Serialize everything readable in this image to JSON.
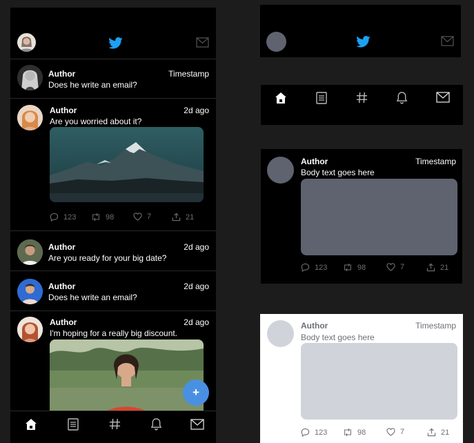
{
  "feed": {
    "tweets": [
      {
        "author": "Author",
        "time": "Timestamp",
        "text": "Does he write an email?"
      },
      {
        "author": "Author",
        "time": "2d ago",
        "text": "Are you worried about it?",
        "actions": {
          "replies": "123",
          "retweets": "98",
          "likes": "7",
          "shares": "21"
        }
      },
      {
        "author": "Author",
        "time": "2d ago",
        "text": "Are you ready for your big date?"
      },
      {
        "author": "Author",
        "time": "2d ago",
        "text": "Does he write an email?"
      },
      {
        "author": "Author",
        "time": "2d ago",
        "text": "I'm hoping for a really big discount."
      }
    ]
  },
  "fab": {
    "label": "+"
  },
  "template_dark": {
    "author": "Author",
    "time": "Timestamp",
    "text": "Body text goes here",
    "actions": {
      "replies": "123",
      "retweets": "98",
      "likes": "7",
      "shares": "21"
    }
  },
  "template_light": {
    "author": "Author",
    "time": "Timestamp",
    "text": "Body text goes here",
    "actions": {
      "replies": "123",
      "retweets": "98",
      "likes": "7",
      "shares": "21"
    }
  },
  "colors": {
    "accent": "#1da1f2",
    "fab": "#4a90e2",
    "panel": "#000000",
    "background": "#1c1c1c",
    "placeholder_dark": "#5f6370",
    "placeholder_light": "#d0d3d9"
  },
  "icons": [
    "twitter-bird-icon",
    "mail-icon",
    "home-icon",
    "document-icon",
    "hashtag-icon",
    "bell-icon",
    "reply-icon",
    "retweet-icon",
    "like-icon",
    "share-icon"
  ]
}
